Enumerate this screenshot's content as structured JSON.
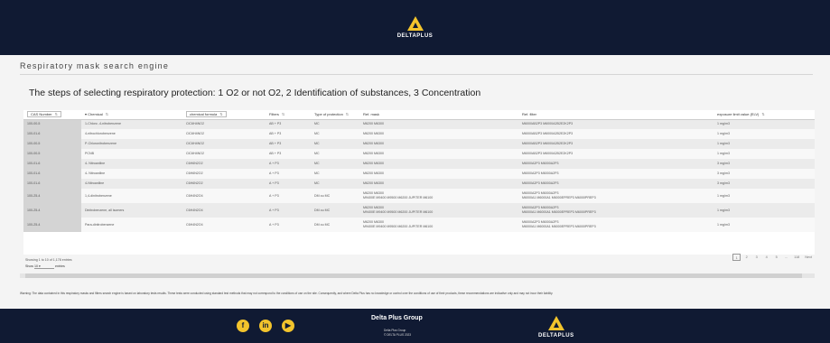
{
  "header": {
    "logo_text": "DELTAPLUS"
  },
  "page": {
    "title": "Respiratory mask search engine",
    "steps": "The steps of selecting respiratory protection: 1 O2 or not O2, 2 Identification of substances, 3 Concentration"
  },
  "table": {
    "columns": {
      "cas": "CAS Number",
      "chemical": "Chemical",
      "formula": "chemical formula",
      "filters": "Filters",
      "protection": "Type of protection",
      "ref_mask": "Ref. mask",
      "ref_filter": "Ref. filter",
      "exposure": "exposure limit value (ELV)"
    },
    "rows": [
      {
        "cas": "100-00-5",
        "chemical": "1-Chloro -4-nitrobenzene",
        "formula": "ClC6H4NO2",
        "filters": "AB + P3",
        "protection": "MC",
        "mask": [
          "M6200 M6300"
        ],
        "filter": [
          "M6000AB2P3 M6000A2B2E2K2P3"
        ],
        "elv": "1 mg/m3"
      },
      {
        "cas": "100-01-6",
        "chemical": "4-nitrochlorobenzene",
        "formula": "ClC6H4NO2",
        "filters": "AB + P3",
        "protection": "MC",
        "mask": [
          "M6200 M6300"
        ],
        "filter": [
          "M6000AB2P3 M6000A2B2E2K2P3"
        ],
        "elv": "1 mg/m3"
      },
      {
        "cas": "100-00-5",
        "chemical": "P-Chloronitrobenzene",
        "formula": "ClC6H4NO2",
        "filters": "AB + P3",
        "protection": "MC",
        "mask": [
          "M6200 M6300"
        ],
        "filter": [
          "M6000AB2P3 M6000A2B2E2K2P3"
        ],
        "elv": "1 mg/m3"
      },
      {
        "cas": "100-00-5",
        "chemical": "PCNB",
        "formula": "ClC6H4NO2",
        "filters": "AB + P3",
        "protection": "MC",
        "mask": [
          "M6200 M6300"
        ],
        "filter": [
          "M6000AB2P3 M6000A2B2E2K2P3"
        ],
        "elv": "1 mg/m3"
      },
      {
        "cas": "100-01-6",
        "chemical": "4- Nitroaniline",
        "formula": "C6H6N2O2",
        "filters": "A + P3",
        "protection": "MC",
        "mask": [
          "M6200 M6300"
        ],
        "filter": [
          "M6000A2P3 M6000A2P3"
        ],
        "elv": "3 mg/m3"
      },
      {
        "cas": "100-01-6",
        "chemical": "4- Nitroaniline",
        "formula": "C6H6N2O2",
        "filters": "A + P3",
        "protection": "MC",
        "mask": [
          "M6200 M6300"
        ],
        "filter": [
          "M6000A2P3 M6000A2P3"
        ],
        "elv": "3 mg/m3"
      },
      {
        "cas": "100-01-6",
        "chemical": "4-Nitroaniline",
        "formula": "C6H6N2O2",
        "filters": "A + P3",
        "protection": "MC",
        "mask": [
          "M6200 M6300"
        ],
        "filter": [
          "M6000A2P3 M6000A2P3"
        ],
        "elv": "3 mg/m3"
      },
      {
        "cas": "100-25-4",
        "chemical": "1,4-dinitrobenzene",
        "formula": "C6H4N2O4",
        "filters": "A + P3",
        "protection": "DM ou MC",
        "mask": [
          "M6200 M6300",
          "M9400E M9400 M9500 M6200 JUPITER M6100"
        ],
        "filter": [
          "M6000A2P3 M6000A2P3",
          "M6000A1 M6000A1 M6000EPREP3 M6000PREP3"
        ],
        "elv": "1 mg/m3"
      },
      {
        "cas": "100-25-4",
        "chemical": "Dinitrobenzene, all isomers",
        "formula": "C6H4N2O4",
        "filters": "A + P3",
        "protection": "DM ou MC",
        "mask": [
          "M6200 M6300",
          "M9400E M9400 M9500 M6200 JUPITER M6100"
        ],
        "filter": [
          "M6000A2P3 M6000A2P3",
          "M6000A1 M6000A1 M6000EPREP3 M6000PREP3"
        ],
        "elv": "1 mg/m3"
      },
      {
        "cas": "100-25-4",
        "chemical": "Para-dinitrobenzene",
        "formula": "C6H4N2O4",
        "filters": "A + P3",
        "protection": "DM ou MC",
        "mask": [
          "M6200 M6300",
          "M9400E M9400 M9500 M6200 JUPITER M6100"
        ],
        "filter": [
          "M6000A2P3 M6000A2P3",
          "M6000A1 M6000A1 M6000EPREP3 M6000PREP3"
        ],
        "elv": "1 mg/m3"
      }
    ]
  },
  "pagination": {
    "info": "Showing 1 to 10 of 1,178 entries",
    "show_label": "Show",
    "show_value": "10",
    "entries_label": "entries",
    "pages": [
      "1",
      "2",
      "3",
      "4",
      "5",
      "...",
      "118",
      "Next"
    ],
    "active": "1"
  },
  "warning": "Warning: The data contained in this respiratory masks and filters search engine is based on laboratory tests results. These tests were conducted using standard test methods that may not correspond to the conditions of use on the site. Consequently, and where Delta Plus has no knowledge or control over the conditions of use of their products, these recommendations are indicative only and may not incur their liability.",
  "footer": {
    "company": "Delta Plus Group",
    "line1": "Delta Plus Group",
    "line2": "© DELTA PLUS 2023",
    "logo_text": "DELTAPLUS",
    "social_icons": [
      "facebook-icon",
      "linkedin-icon",
      "youtube-icon"
    ]
  },
  "colors": {
    "navy": "#101a33",
    "yellow": "#f3c42c"
  }
}
